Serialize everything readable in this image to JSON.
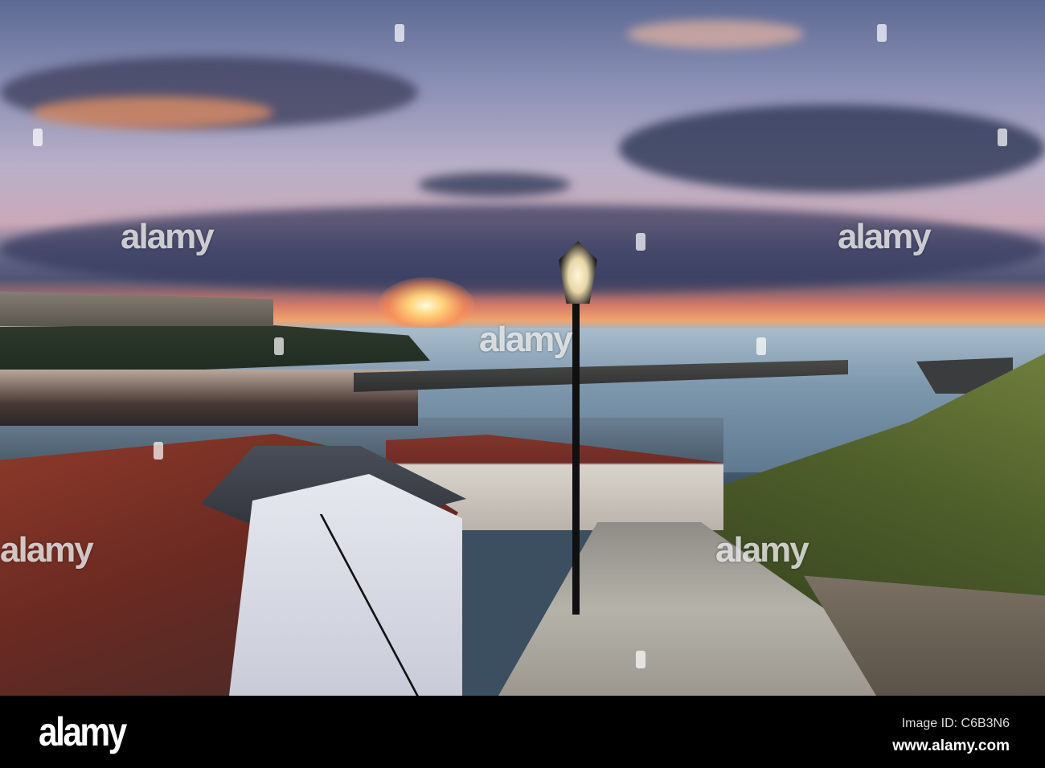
{
  "photo": {
    "subject": "Sunset over harbour with lamp post and stone steps",
    "watermark_text": "alamy"
  },
  "footer": {
    "logo": "alamy",
    "image_id": "Image ID: C6B3N6",
    "url": "www.alamy.com"
  },
  "colors": {
    "sky": "#8a8fb5",
    "sun": "#ffd27a",
    "sea": "#7d97ad",
    "roofs": "#8e3a2a"
  }
}
